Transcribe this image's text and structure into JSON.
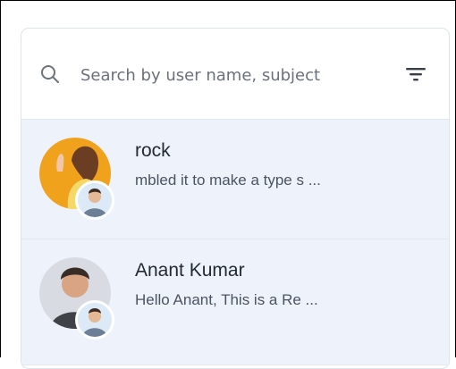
{
  "search": {
    "placeholder": "Search by user name, subject"
  },
  "conversations": [
    {
      "name": "rock",
      "preview": "mbled it to make a type s ..."
    },
    {
      "name": "Anant Kumar",
      "preview": "Hello Anant, This is a Re ..."
    }
  ],
  "colors": {
    "list_background": "#eef3fb",
    "panel_border": "#dfe3ea",
    "text_primary": "#242a33",
    "text_secondary": "#4c5360"
  },
  "icons": {
    "search": "search-icon",
    "filter": "filter-icon"
  }
}
